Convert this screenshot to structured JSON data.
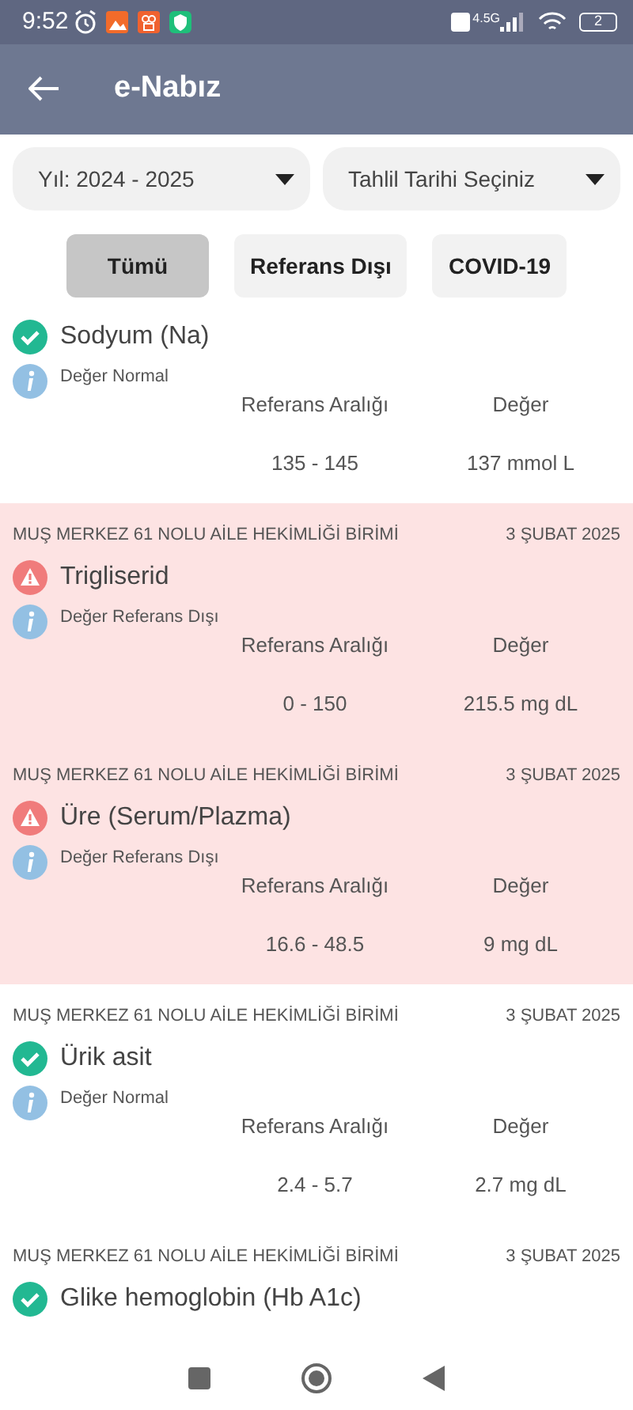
{
  "status_bar": {
    "time": "9:52",
    "network": "4.5G",
    "battery": "2"
  },
  "app_bar": {
    "title": "e-Nabız"
  },
  "filters": [
    {
      "label": "Yıl: 2024 - 2025"
    },
    {
      "label": "Tahlil Tarihi Seçiniz"
    }
  ],
  "tabs": [
    {
      "label": "Tümü",
      "selected": true
    },
    {
      "label": "Referans Dışı",
      "selected": false
    },
    {
      "label": "COVID-19",
      "selected": false
    }
  ],
  "results": [
    {
      "name": "Sodyum (Na)",
      "abnormal": false,
      "status_text": "Değer Normal",
      "reference_label": "Referans Aralığı",
      "value_label": "Değer",
      "reference": "135 - 145",
      "value": "137 mmol L"
    },
    {
      "facility": "MUŞ MERKEZ 61 NOLU AİLE HEKİMLİĞİ BİRİMİ",
      "date": "3 ŞUBAT 2025",
      "name": "Trigliserid",
      "abnormal": true,
      "status_text": "Değer Referans Dışı",
      "reference_label": "Referans Aralığı",
      "value_label": "Değer",
      "reference": "0 - 150",
      "value": "215.5 mg dL"
    },
    {
      "facility": "MUŞ MERKEZ 61 NOLU AİLE HEKİMLİĞİ BİRİMİ",
      "date": "3 ŞUBAT 2025",
      "name": "Üre (Serum/Plazma)",
      "abnormal": true,
      "status_text": "Değer Referans Dışı",
      "reference_label": "Referans Aralığı",
      "value_label": "Değer",
      "reference": "16.6 - 48.5",
      "value": "9 mg dL"
    },
    {
      "facility": "MUŞ MERKEZ 61 NOLU AİLE HEKİMLİĞİ BİRİMİ",
      "date": "3 ŞUBAT 2025",
      "name": "Ürik asit",
      "abnormal": false,
      "status_text": "Değer Normal",
      "reference_label": "Referans Aralığı",
      "value_label": "Değer",
      "reference": "2.4 - 5.7",
      "value": "2.7 mg dL"
    },
    {
      "facility": "MUŞ MERKEZ 61 NOLU AİLE HEKİMLİĞİ BİRİMİ",
      "date": "3 ŞUBAT 2025",
      "name": "Glike hemoglobin (Hb A1c)",
      "abnormal": false
    }
  ]
}
